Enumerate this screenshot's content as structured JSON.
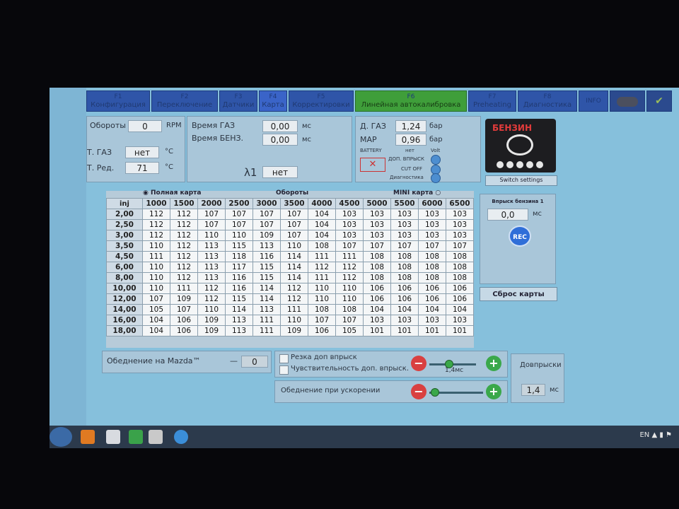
{
  "tabs": [
    {
      "key": "F1",
      "label": "Конфигурация"
    },
    {
      "key": "F2",
      "label": "Переключение"
    },
    {
      "key": "F3",
      "label": "Датчики"
    },
    {
      "key": "F4",
      "label": "Карта"
    },
    {
      "key": "F5",
      "label": "Корректировки"
    },
    {
      "key": "F6",
      "label": "Линейная автокалибровка"
    },
    {
      "key": "F7",
      "label": "Preheating"
    },
    {
      "key": "F8",
      "label": "Диагностика"
    },
    {
      "key": "INFO",
      "label": ""
    }
  ],
  "sensors": {
    "rpm_label": "Обороты",
    "rpm_value": "0",
    "rpm_unit": "RPM",
    "gas_temp_label": "Т. ГАЗ",
    "gas_temp_value": "нет",
    "gas_temp_unit": "°C",
    "red_temp_label": "Т. Ред.",
    "red_temp_value": "71",
    "red_temp_unit": "°C",
    "time_gas_label": "Время ГАЗ",
    "time_gas_value": "0,00",
    "time_gas_unit": "мс",
    "time_benz_label": "Время БЕНЗ.",
    "time_benz_value": "0,00",
    "time_benz_unit": "мс",
    "lambda_label": "λ1",
    "lambda_value": "нет",
    "p_gas_label": "Д. ГАЗ",
    "p_gas_value": "1,24",
    "p_gas_unit": "бар",
    "map_label": "MAP",
    "map_value": "0,96",
    "map_unit": "бар",
    "battery_label": "BATTERY",
    "battery_value": "нет",
    "battery_unit": "Volt",
    "ind1": "ДОП. ВПРЫСК",
    "ind2": "CUT OFF",
    "ind3": "Диагностика"
  },
  "fuel": {
    "title": "БЕНЗИН",
    "switch_label": "Switch settings"
  },
  "map_table": {
    "corner_top": "Время",
    "corner_bottom": "inj",
    "full_map_label": "Полная карта",
    "rpm_title": "Обороты",
    "mini_map_label": "MINI карта",
    "rpm": [
      "1000",
      "1500",
      "2000",
      "2500",
      "3000",
      "3500",
      "4000",
      "4500",
      "5000",
      "5500",
      "6000",
      "6500"
    ],
    "rows": [
      {
        "t": "2,00",
        "v": [
          "112",
          "112",
          "107",
          "107",
          "107",
          "107",
          "104",
          "103",
          "103",
          "103",
          "103",
          "103"
        ]
      },
      {
        "t": "2,50",
        "v": [
          "112",
          "112",
          "107",
          "107",
          "107",
          "107",
          "104",
          "103",
          "103",
          "103",
          "103",
          "103"
        ]
      },
      {
        "t": "3,00",
        "v": [
          "112",
          "112",
          "110",
          "110",
          "109",
          "107",
          "104",
          "103",
          "103",
          "103",
          "103",
          "103"
        ]
      },
      {
        "t": "3,50",
        "v": [
          "110",
          "112",
          "113",
          "115",
          "113",
          "110",
          "108",
          "107",
          "107",
          "107",
          "107",
          "107"
        ]
      },
      {
        "t": "4,50",
        "v": [
          "111",
          "112",
          "113",
          "118",
          "116",
          "114",
          "111",
          "111",
          "108",
          "108",
          "108",
          "108"
        ]
      },
      {
        "t": "6,00",
        "v": [
          "110",
          "112",
          "113",
          "117",
          "115",
          "114",
          "112",
          "112",
          "108",
          "108",
          "108",
          "108"
        ]
      },
      {
        "t": "8,00",
        "v": [
          "110",
          "112",
          "113",
          "116",
          "115",
          "114",
          "111",
          "112",
          "108",
          "108",
          "108",
          "108"
        ]
      },
      {
        "t": "10,00",
        "v": [
          "110",
          "111",
          "112",
          "116",
          "114",
          "112",
          "110",
          "110",
          "106",
          "106",
          "106",
          "106"
        ]
      },
      {
        "t": "12,00",
        "v": [
          "107",
          "109",
          "112",
          "115",
          "114",
          "112",
          "110",
          "110",
          "106",
          "106",
          "106",
          "106"
        ]
      },
      {
        "t": "14,00",
        "v": [
          "105",
          "107",
          "110",
          "114",
          "113",
          "111",
          "108",
          "108",
          "104",
          "104",
          "104",
          "104"
        ]
      },
      {
        "t": "16,00",
        "v": [
          "104",
          "106",
          "109",
          "113",
          "111",
          "110",
          "107",
          "107",
          "103",
          "103",
          "103",
          "103"
        ]
      },
      {
        "t": "18,00",
        "v": [
          "104",
          "106",
          "109",
          "113",
          "111",
          "109",
          "106",
          "105",
          "101",
          "101",
          "101",
          "101"
        ]
      }
    ]
  },
  "injection": {
    "title": "Впрыск бензина 1",
    "value": "0,0",
    "unit": "мс",
    "rec_label": "REC",
    "reset_label": "Сброс карты"
  },
  "bottom": {
    "mazda_label": "Обеднение на Mazda™",
    "mazda_dash": "—",
    "mazda_value": "0",
    "sharp_label": "Резка доп впрыск",
    "sens_label": "Чувствительность доп. впрыск.",
    "slider1_value": "1,4мс",
    "lean_label": "Обеднение при ускорении",
    "dop_title": "Довпрыски",
    "dop_value": "1,4",
    "dop_unit": "мс"
  },
  "taskbar": {
    "lang": "EN"
  }
}
